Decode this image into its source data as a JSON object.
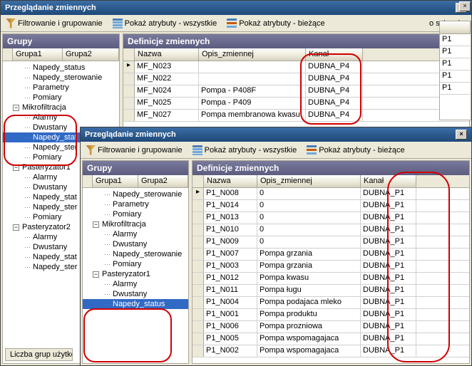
{
  "back_window": {
    "title": "Przeglądanie zmiennych",
    "toolbar": {
      "filter": "Filtrowanie i grupowanie",
      "attr_all": "Pokaż atrybuty - wszystkie",
      "attr_current": "Pokaż atrybuty - bieżące",
      "clipboard": "o schowka"
    },
    "groups": {
      "header": "Grupy",
      "col1": "Grupa1",
      "col2": "Grupa2",
      "items_top": [
        "Napedy_status",
        "Napedy_sterowanie",
        "Parametry",
        "Pomiary"
      ],
      "mikro": {
        "label": "Mikrofiltracja",
        "children": [
          "Alarmy",
          "Dwustany",
          "Napedy_stat",
          "Napedy_ster",
          "Pomiary"
        ]
      },
      "past1": {
        "label": "Pasteryzator1",
        "children": [
          "Alarmy",
          "Dwustany",
          "Napedy_stat",
          "Napedy_ster",
          "Pomiary"
        ]
      },
      "past2": {
        "label": "Pasteryzator2",
        "children": [
          "Alarmy",
          "Dwustany",
          "Napedy_stat",
          "Napedy_ster"
        ]
      },
      "footer_btn": "Liczba grup użytkow"
    },
    "defs": {
      "header": "Definicje zmiennych",
      "cols": {
        "c1": "Nazwa",
        "c2": "Opis_zmiennej",
        "c3": "Kanał"
      },
      "rows": [
        {
          "n": "MF_N023",
          "o": "",
          "k": "DUBNA_P4"
        },
        {
          "n": "MF_N022",
          "o": "",
          "k": "DUBNA_P4"
        },
        {
          "n": "MF_N024",
          "o": "Pompa - P408F",
          "k": "DUBNA_P4"
        },
        {
          "n": "MF_N025",
          "o": "Pompa - P409",
          "k": "DUBNA_P4"
        },
        {
          "n": "MF_N027",
          "o": "Pompa membranowa kwasu",
          "k": "DUBNA_P4"
        }
      ]
    },
    "edge_col": {
      "h": "",
      "rows": [
        "P1",
        "P1",
        "P1",
        "P1",
        "P1"
      ]
    }
  },
  "front_window": {
    "title": "Przeglądanie zmiennych",
    "toolbar": {
      "filter": "Filtrowanie i grupowanie",
      "attr_all": "Pokaż atrybuty - wszystkie",
      "attr_current": "Pokaż atrybuty - bieżące"
    },
    "groups": {
      "header": "Grupy",
      "col1": "Grupa1",
      "col2": "Grupa2",
      "items_top": [
        "Napedy_sterowanie",
        "Parametry",
        "Pomiary"
      ],
      "mikro": {
        "label": "Mikrofiltracja",
        "children": [
          "Alarmy",
          "Dwustany",
          "Napedy_sterowanie",
          "Pomiary"
        ]
      },
      "past1": {
        "label": "Pasteryzator1",
        "children": [
          "Alarmy",
          "Dwustany",
          "Napedy_status"
        ]
      }
    },
    "defs": {
      "header": "Definicje zmiennych",
      "cols": {
        "c1": "Nazwa",
        "c2": "Opis_zmiennej",
        "c3": "Kanał"
      },
      "rows": [
        {
          "n": "P1_N008",
          "o": "0",
          "k": "DUBNA_P1"
        },
        {
          "n": "P1_N014",
          "o": "0",
          "k": "DUBNA_P1"
        },
        {
          "n": "P1_N013",
          "o": "0",
          "k": "DUBNA_P1"
        },
        {
          "n": "P1_N010",
          "o": "0",
          "k": "DUBNA_P1"
        },
        {
          "n": "P1_N009",
          "o": "0",
          "k": "DUBNA_P1"
        },
        {
          "n": "P1_N007",
          "o": "Pompa grzania",
          "k": "DUBNA_P1"
        },
        {
          "n": "P1_N003",
          "o": "Pompa grzania",
          "k": "DUBNA_P1"
        },
        {
          "n": "P1_N012",
          "o": "Pompa kwasu",
          "k": "DUBNA_P1"
        },
        {
          "n": "P1_N011",
          "o": "Pompa ługu",
          "k": "DUBNA_P1"
        },
        {
          "n": "P1_N004",
          "o": "Pompa podajaca mleko",
          "k": "DUBNA_P1"
        },
        {
          "n": "P1_N001",
          "o": "Pompa produktu",
          "k": "DUBNA_P1"
        },
        {
          "n": "P1_N006",
          "o": "Pompa prozniowa",
          "k": "DUBNA_P1"
        },
        {
          "n": "P1_N005",
          "o": "Pompa wspomagajaca",
          "k": "DUBNA_P1"
        },
        {
          "n": "P1_N002",
          "o": "Pompa wspomagajaca",
          "k": "DUBNA_P1"
        }
      ]
    }
  }
}
